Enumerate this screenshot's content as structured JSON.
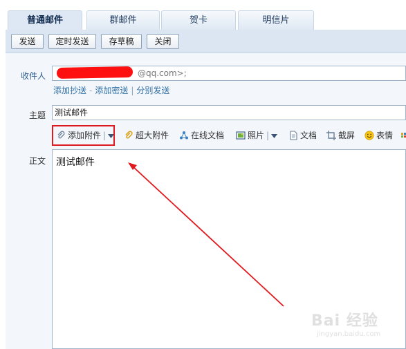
{
  "tabs": [
    {
      "label": "普通邮件",
      "active": true
    },
    {
      "label": "群邮件",
      "active": false
    },
    {
      "label": "贺卡",
      "active": false
    },
    {
      "label": "明信片",
      "active": false
    }
  ],
  "toolbar": {
    "send": "发送",
    "timed_send": "定时发送",
    "save_draft": "存草稿",
    "close": "关闭"
  },
  "recipient": {
    "label": "收件人",
    "value_visible": "@qq.com>;",
    "add_cc": "添加抄送",
    "add_bcc": "添加密送",
    "separate_send": "分别发送"
  },
  "subject": {
    "label": "主题",
    "value": "测试邮件"
  },
  "attachments_bar": {
    "add_attachment": "添加附件",
    "large_attachment": "超大附件",
    "online_doc": "在线文档",
    "photo": "照片",
    "document": "文档",
    "screenshot": "截屏",
    "emoji": "表情"
  },
  "body": {
    "label": "正文",
    "value": "测试邮件"
  },
  "watermark": {
    "main": "Bai 经验",
    "sub": "jingyan.baidu.com"
  },
  "colors": {
    "annotation_red": "#e0191e",
    "link_blue": "#2f6ea5",
    "toolbar_bg": "#dbe6f2"
  }
}
